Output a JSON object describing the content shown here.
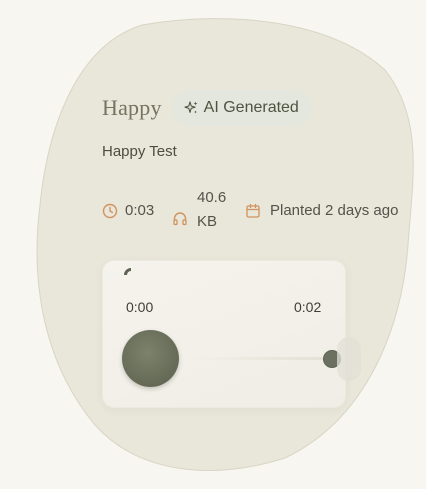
{
  "card": {
    "title": "Happy",
    "badge_label": "AI Generated",
    "badge_icon": "sparkles-icon",
    "description": "Happy Test"
  },
  "meta": {
    "duration": "0:03",
    "duration_icon": "clock-icon",
    "size": "40.6 KB",
    "size_icon": "headphones-icon",
    "planted": "Planted 2 days ago",
    "planted_icon": "calendar-icon"
  },
  "player": {
    "current_time": "0:00",
    "total_time": "0:02",
    "progress": 1.0,
    "play_icon": "play-button"
  },
  "colors": {
    "background": "#f7f6f1",
    "blob": "#e9e6da",
    "accent_olive": "#676c58",
    "icon_orange": "#d1935f",
    "badge_bg": "#e4e7dd"
  }
}
